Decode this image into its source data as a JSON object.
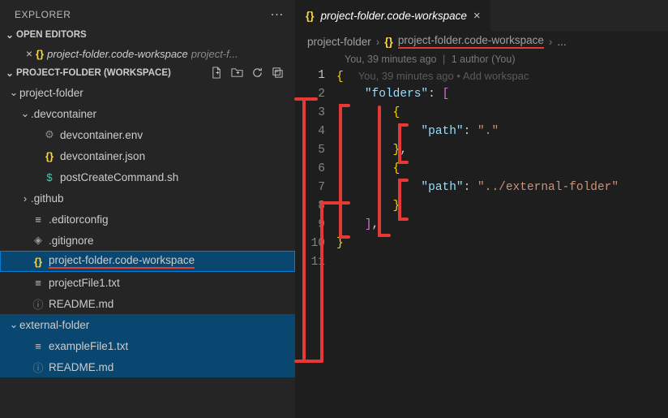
{
  "explorer": {
    "title": "EXPLORER",
    "open_editors_label": "OPEN EDITORS",
    "workspace_label": "PROJECT-FOLDER (WORKSPACE)",
    "open_editors": [
      {
        "icon": "{}",
        "label": "project-folder.code-workspace",
        "path": "project-f..."
      }
    ],
    "tree": [
      {
        "depth": 0,
        "kind": "folder-open",
        "label": "project-folder"
      },
      {
        "depth": 1,
        "kind": "folder-open",
        "label": ".devcontainer"
      },
      {
        "depth": 2,
        "kind": "file",
        "icon": "gear",
        "label": "devcontainer.env"
      },
      {
        "depth": 2,
        "kind": "file",
        "icon": "json",
        "label": "devcontainer.json"
      },
      {
        "depth": 2,
        "kind": "file",
        "icon": "dollar",
        "label": "postCreateCommand.sh"
      },
      {
        "depth": 1,
        "kind": "folder-closed",
        "label": ".github"
      },
      {
        "depth": 1,
        "kind": "file",
        "icon": "lines",
        "label": ".editorconfig"
      },
      {
        "depth": 1,
        "kind": "file",
        "icon": "ignore",
        "label": ".gitignore"
      },
      {
        "depth": 1,
        "kind": "file",
        "icon": "json",
        "label": "project-folder.code-workspace",
        "selected": true,
        "underline": true
      },
      {
        "depth": 1,
        "kind": "file",
        "icon": "lines",
        "label": "projectFile1.txt"
      },
      {
        "depth": 1,
        "kind": "file",
        "icon": "info",
        "label": "README.md"
      },
      {
        "depth": 0,
        "kind": "folder-open",
        "label": "external-folder",
        "pselected": true
      },
      {
        "depth": 1,
        "kind": "file",
        "icon": "lines",
        "label": "exampleFile1.txt",
        "pselected": true
      },
      {
        "depth": 1,
        "kind": "file",
        "icon": "info",
        "label": "README.md",
        "pselected": true
      }
    ]
  },
  "editor": {
    "tab": {
      "icon": "{}",
      "label": "project-folder.code-workspace"
    },
    "breadcrumb": {
      "parts": [
        "project-folder",
        "project-folder.code-workspace",
        "..."
      ],
      "underline_index": 1
    },
    "gitlens": {
      "author": "You, 39 minutes ago",
      "authors": "1 author (You)"
    },
    "inline_blame": "You, 39 minutes ago • Add workspac",
    "code_lines": [
      "{",
      "    \"folders\": [",
      "        {",
      "            \"path\": \".\"",
      "        },",
      "        {",
      "            \"path\": \"../external-folder\"",
      "        }",
      "    ],",
      "}",
      ""
    ],
    "line_count": 11,
    "active_line": 1
  },
  "chart_data": {
    "type": "table",
    "title": "project-folder.code-workspace contents",
    "folders": [
      {
        "path": "."
      },
      {
        "path": "../external-folder"
      }
    ]
  }
}
